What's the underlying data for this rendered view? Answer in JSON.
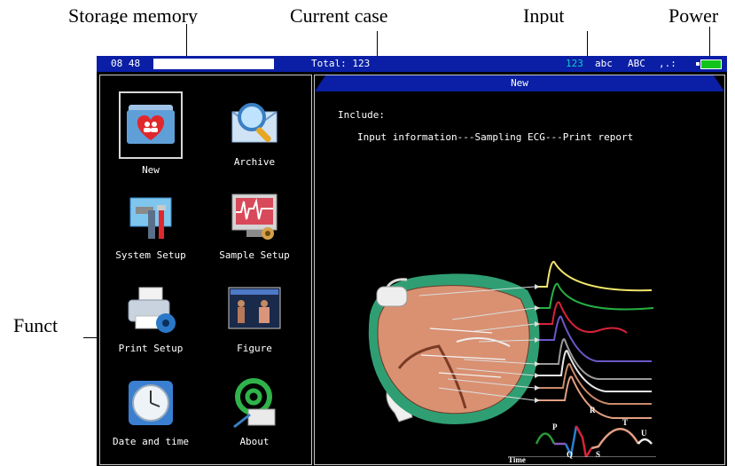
{
  "callouts": {
    "storage_memory": "Storage    memory",
    "current_case": "Current    case",
    "input": "Input",
    "power": "Power",
    "function": "Funct"
  },
  "statusbar": {
    "time": "08 48",
    "total": "Total: 123",
    "input_modes": [
      "123",
      "abc",
      "ABC",
      ",.:"
    ],
    "storage_fill": 1.0,
    "battery_fill": 1.0
  },
  "functions": [
    {
      "label": "New",
      "icon": "new-case-folder-icon",
      "selected": true
    },
    {
      "label": "Archive",
      "icon": "archive-search-icon",
      "selected": false
    },
    {
      "label": "System Setup",
      "icon": "system-setup-tools-icon",
      "selected": false
    },
    {
      "label": "Sample Setup",
      "icon": "sample-setup-ecg-icon",
      "selected": false
    },
    {
      "label": "Print Setup",
      "icon": "printer-icon",
      "selected": false
    },
    {
      "label": "Figure",
      "icon": "figure-body-icon",
      "selected": false
    },
    {
      "label": "Date and time",
      "icon": "clock-icon",
      "selected": false
    },
    {
      "label": "About",
      "icon": "about-at-icon",
      "selected": false
    }
  ],
  "content": {
    "title": "New",
    "include_label": "Include:",
    "flow_text": "Input information---Sampling ECG---Print report",
    "ecg_labels": {
      "p": "P",
      "q": "Q",
      "r": "R",
      "s": "S",
      "t": "T",
      "u": "U",
      "time": "Time"
    }
  },
  "colors": {
    "status_bar": "#0a1fa5",
    "screen_bg": "#000000",
    "input_mode_active": "#19c8c8",
    "battery": "#11c41c"
  }
}
